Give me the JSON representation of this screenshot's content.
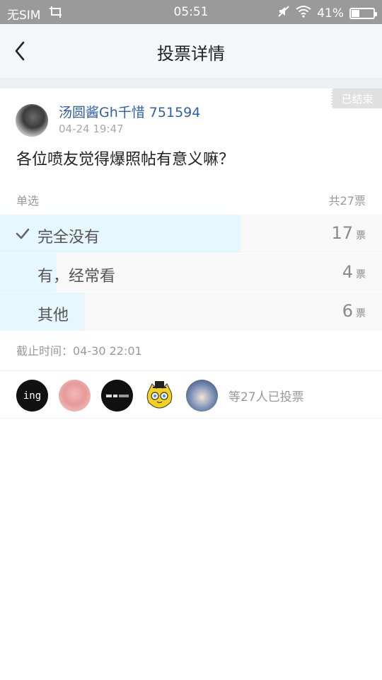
{
  "status_bar": {
    "carrier": "无SIM",
    "time": "05:51",
    "battery_percent_text": "41%",
    "battery_level": 0.41
  },
  "nav": {
    "title": "投票详情"
  },
  "post": {
    "status_badge": "已结束",
    "author": "汤圆酱Gh千惜 751594",
    "time": "04-24 19:47",
    "question": "各位喷友觉得爆照帖有意义嘛？"
  },
  "poll": {
    "type_label": "单选",
    "total_label": "共27票",
    "unit": "票",
    "options": [
      {
        "label": "完全没有",
        "count": "17",
        "fraction": 0.63,
        "selected": true
      },
      {
        "label": "有，经常看",
        "count": "4",
        "fraction": 0.148,
        "selected": false
      },
      {
        "label": "其他",
        "count": "6",
        "fraction": 0.222,
        "selected": false
      }
    ],
    "deadline": "截止时间：04-30 22:01"
  },
  "voters": {
    "avatars": [
      {
        "name": "voter-avatar-1",
        "text": "ing"
      },
      {
        "name": "voter-avatar-2",
        "text": ""
      },
      {
        "name": "voter-avatar-3",
        "text": ""
      },
      {
        "name": "voter-avatar-4",
        "text": ""
      },
      {
        "name": "voter-avatar-5",
        "text": ""
      }
    ],
    "summary": "等27人已投票"
  },
  "colors": {
    "author": "#2f5fa7",
    "option_fill": "#e6f7fd",
    "status_bar": "#9a9a9a"
  }
}
